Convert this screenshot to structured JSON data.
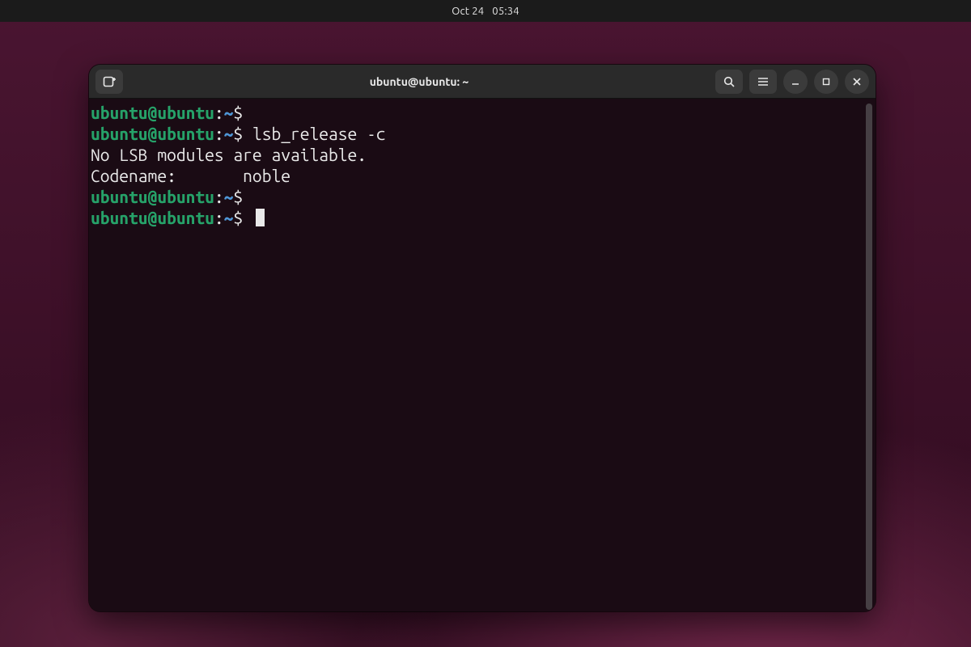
{
  "topbar": {
    "date": "Oct 24",
    "time": "05:34"
  },
  "window": {
    "title": "ubuntu@ubuntu: ~",
    "buttons": {
      "newtab_icon": "new-tab-icon",
      "search_icon": "search-icon",
      "menu_icon": "hamburger-icon",
      "min_icon": "minimize-icon",
      "max_icon": "maximize-icon",
      "close_icon": "close-icon"
    }
  },
  "prompt": {
    "user_host": "ubuntu@ubuntu",
    "sep": ":",
    "path": "~",
    "symbol": "$"
  },
  "lines": [
    {
      "type": "prompt",
      "cmd": ""
    },
    {
      "type": "prompt",
      "cmd": " lsb_release -c"
    },
    {
      "type": "output",
      "text": "No LSB modules are available."
    },
    {
      "type": "output",
      "text": "Codename:\tnoble"
    },
    {
      "type": "prompt",
      "cmd": ""
    },
    {
      "type": "prompt_cursor",
      "cmd": " "
    }
  ]
}
